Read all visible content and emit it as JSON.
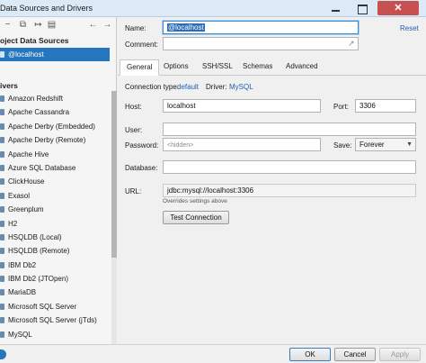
{
  "window": {
    "title": "Data Sources and Drivers"
  },
  "left_panel": {
    "project_header": "oject Data Sources",
    "selected_source": "@localhost",
    "drivers_header": "ivers",
    "drivers": [
      "Amazon Redshift",
      "Apache Cassandra",
      "Apache Derby (Embedded)",
      "Apache Derby (Remote)",
      "Apache Hive",
      "Azure SQL Database",
      "ClickHouse",
      "Exasol",
      "Greenplum",
      "H2",
      "HSQLDB (Local)",
      "HSQLDB (Remote)",
      "IBM Db2",
      "IBM Db2 (JTOpen)",
      "MariaDB",
      "Microsoft SQL Server",
      "Microsoft SQL Server (jTds)",
      "MySQL"
    ]
  },
  "form": {
    "name_label": "Name:",
    "name_value": "@localhost",
    "reset_label": "Reset",
    "comment_label": "Comment:",
    "comment_value": "",
    "tabs": [
      "General",
      "Options",
      "SSH/SSL",
      "Schemas",
      "Advanced"
    ],
    "connection_type_label": "Connection type:",
    "connection_type_value": "default",
    "driver_label": "Driver:",
    "driver_value": "MySQL",
    "host_label": "Host:",
    "host_value": "localhost",
    "port_label": "Port:",
    "port_value": "3306",
    "user_label": "User:",
    "user_value": "",
    "password_label": "Password:",
    "password_placeholder": "<hidden>",
    "save_label": "Save:",
    "save_value": "Forever",
    "database_label": "Database:",
    "database_value": "",
    "url_label": "URL:",
    "url_value": "jdbc:mysql://localhost:3306",
    "url_hint": "Overrides settings above",
    "test_connection_label": "Test Connection"
  },
  "footer": {
    "ok_label": "OK",
    "cancel_label": "Cancel",
    "apply_label": "Apply"
  }
}
